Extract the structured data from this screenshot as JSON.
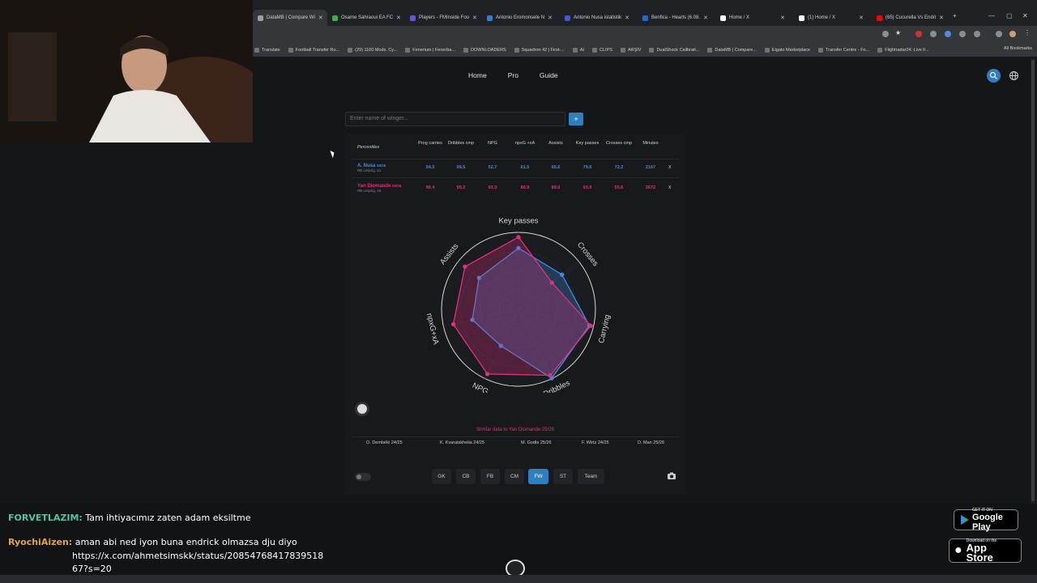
{
  "browser": {
    "tabs": [
      {
        "label": "DataMB | Compare Wi",
        "color": "#9aa0a6",
        "active": true
      },
      {
        "label": "Osame Sahraoui EA FC",
        "color": "#3fae49"
      },
      {
        "label": "Players - FMInside Foo",
        "color": "#5b5bd6"
      },
      {
        "label": "Antonio Eromonsele N",
        "color": "#2f7de1"
      },
      {
        "label": "Antonio Nusa istatistik",
        "color": "#3b5bdb"
      },
      {
        "label": "Benfica - Hearts (6.08.",
        "color": "#1e6bd6"
      },
      {
        "label": "Home / X",
        "color": "#ffffff"
      },
      {
        "label": "(1) Home / X",
        "color": "#ffffff"
      },
      {
        "label": "(65) Cucurella Vs Endri",
        "color": "#ff0000"
      }
    ],
    "bookmarks": [
      "Translate",
      "Football Transfer Ru...",
      "(29) 1100 Mods. Cy...",
      "Fenerium | Fenerba...",
      "DOWNLOADERS",
      "Squadron 42 | First-...",
      "AI",
      "CLIPS",
      "ARŞİV",
      "DualShock Calibrati...",
      "DataMB | Compare...",
      "Elgato Marketplace",
      "Transfer Centre - Fo...",
      "Flightradar24: Live F..."
    ],
    "all_bookmarks": "All Bookmarks"
  },
  "nav": {
    "home": "Home",
    "pro": "Pro",
    "guide": "Guide"
  },
  "search": {
    "placeholder": "Enter name of winger...",
    "add_label": "+"
  },
  "table": {
    "percentiles_label": "Percentiles",
    "columns": [
      "Prog carries",
      "Dribbles cmp",
      "NPG",
      "npxG +xA",
      "Assists",
      "Key passes",
      "Crosses cmp",
      "Minutes"
    ],
    "rows": [
      {
        "name": "A. Nusa",
        "season": "25/26",
        "team": "RB Leipzig, 21",
        "color": "#3d8fe0",
        "values": [
          "94.3",
          "99.5",
          "52.7",
          "61.5",
          "65.6",
          "79.6",
          "72.2",
          "2167"
        ],
        "remove": "x"
      },
      {
        "name": "Yan Diomande",
        "season": "25/26",
        "team": "RB Leipzig, 19",
        "color": "#e0307c",
        "values": [
          "96.4",
          "95.2",
          "93.3",
          "86.9",
          "89.0",
          "93.9",
          "55.6",
          "2672"
        ],
        "remove": "x"
      }
    ]
  },
  "radar": {
    "axes": [
      "Key passes",
      "Crosses",
      "Carrying",
      "Dribbles",
      "NPG",
      "npxG+xA",
      "Assists"
    ],
    "series": [
      {
        "name": "A. Nusa",
        "color": "#3d8fe0",
        "values": [
          0.796,
          0.722,
          0.943,
          0.995,
          0.527,
          0.615,
          0.656
        ]
      },
      {
        "name": "Yan Diomande",
        "color": "#e0307c",
        "values": [
          0.939,
          0.556,
          0.964,
          0.952,
          0.933,
          0.869,
          0.89
        ]
      }
    ]
  },
  "similar": {
    "title": "Similar data to Yan Diomande 25/26",
    "players": [
      "O. Dembélé 24/25",
      "K. Kvaratskhelia 24/25",
      "M. Godts 25/26",
      "F. Wirtz 24/25",
      "D. Man 25/26"
    ]
  },
  "positions": [
    "GK",
    "CB",
    "FB",
    "CM",
    "FW",
    "ST",
    "Team"
  ],
  "active_position": "FW",
  "chat": [
    {
      "user": "FORVETLAZIM:",
      "user_color": "#4ec6a0",
      "text": "Tam ihtiyacımız zaten adam eksiltme"
    },
    {
      "user": "RyochiAizen:",
      "user_color": "#e0a24e",
      "text": "aman abi ned iyon buna endrick olmazsa dju diyo",
      "text2": "https://x.com/ahmetsimskk/status/20854768417839518",
      "text3": "67?s=20"
    }
  ],
  "stores": {
    "google_small": "GET IT ON",
    "google_big": "Google Play",
    "apple_small": "Download on the",
    "apple_big": "App Store"
  }
}
